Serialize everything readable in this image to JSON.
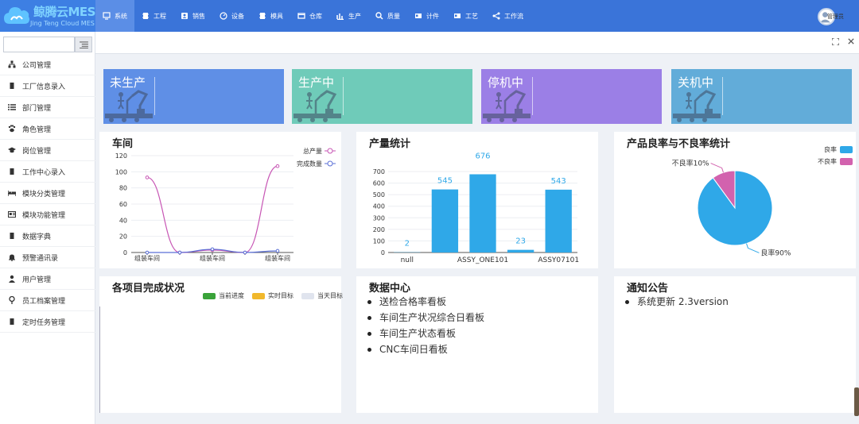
{
  "brand": {
    "title": "鲸腾云MES",
    "subtitle": "Jing Teng Cloud MES"
  },
  "nav": [
    {
      "label": "系统",
      "icon": "monitor-icon",
      "active": true
    },
    {
      "label": "工程",
      "icon": "chip-icon"
    },
    {
      "label": "销售",
      "icon": "user-badge-icon"
    },
    {
      "label": "设备",
      "icon": "gauge-icon"
    },
    {
      "label": "模具",
      "icon": "chip-icon"
    },
    {
      "label": "仓库",
      "icon": "window-icon"
    },
    {
      "label": "生产",
      "icon": "bar-chart-icon"
    },
    {
      "label": "质量",
      "icon": "search-icon"
    },
    {
      "label": "计件",
      "icon": "card-icon"
    },
    {
      "label": "工艺",
      "icon": "card-icon"
    },
    {
      "label": "工作流",
      "icon": "share-icon"
    }
  ],
  "user": {
    "name": "管理员"
  },
  "sidebar": {
    "search_placeholder": "",
    "items": [
      {
        "label": "公司管理",
        "icon": "sitemap-icon"
      },
      {
        "label": "工厂信息录入",
        "icon": "chip-icon"
      },
      {
        "label": "部门管理",
        "icon": "list-icon"
      },
      {
        "label": "角色管理",
        "icon": "paw-icon"
      },
      {
        "label": "岗位管理",
        "icon": "graduation-cap-icon"
      },
      {
        "label": "工作中心录入",
        "icon": "chip-icon"
      },
      {
        "label": "模块分类管理",
        "icon": "bed-icon"
      },
      {
        "label": "模块功能管理",
        "icon": "id-card-icon"
      },
      {
        "label": "数据字典",
        "icon": "chip-icon"
      },
      {
        "label": "预警通讯录",
        "icon": "bell-icon"
      },
      {
        "label": "用户管理",
        "icon": "user-icon"
      },
      {
        "label": "员工档案管理",
        "icon": "map-pin-icon"
      },
      {
        "label": "定时任务管理",
        "icon": "chip-icon"
      }
    ]
  },
  "status_cards": [
    {
      "label": "未生产",
      "color": "#5f8fe6"
    },
    {
      "label": "生产中",
      "color": "#6fcbb9"
    },
    {
      "label": "停机中",
      "color": "#9b7fe6"
    },
    {
      "label": "关机中",
      "color": "#62acd9"
    }
  ],
  "panels": {
    "workshop": {
      "title": "车间"
    },
    "output": {
      "title": "产量统计"
    },
    "yield": {
      "title": "产品良率与不良率统计"
    },
    "project": {
      "title": "各项目完成状况",
      "legend": [
        "当前进度",
        "实时目标",
        "当天目标"
      ],
      "legend_colors": [
        "#3aa33a",
        "#f1b82c",
        "#e0e4ee"
      ]
    },
    "datacenter": {
      "title": "数据中心",
      "items": [
        "送检合格率看板",
        "车间生产状况综合日看板",
        "车间生产状态看板",
        "CNC车间日看板"
      ]
    },
    "notice": {
      "title": "通知公告",
      "items": [
        "系统更新 2.3version"
      ]
    }
  },
  "chart_data": [
    {
      "type": "line",
      "title": "车间",
      "categories": [
        "组装车间",
        "",
        "组装车间",
        "",
        "组装车间"
      ],
      "series": [
        {
          "name": "总产量",
          "values": [
            93,
            0,
            3,
            0,
            107
          ],
          "color": "#c755b4"
        },
        {
          "name": "完成数量",
          "values": [
            0,
            0,
            4,
            0,
            2
          ],
          "color": "#5a6fd6"
        }
      ],
      "ylim": [
        0,
        120
      ],
      "yticks": [
        0,
        20,
        40,
        60,
        80,
        100,
        120
      ],
      "legend": "top-right"
    },
    {
      "type": "bar",
      "title": "产量统计",
      "categories": [
        "null",
        "",
        "ASSY_ONE101",
        "",
        "ASSY07101"
      ],
      "values": [
        2,
        545,
        676,
        23,
        543
      ],
      "ylim": [
        0,
        700
      ],
      "yticks": [
        0,
        100,
        200,
        300,
        400,
        500,
        600,
        700
      ],
      "color": "#2fa8e8"
    },
    {
      "type": "pie",
      "title": "产品良率与不良率统计",
      "slices": [
        {
          "name": "良率",
          "value": 90,
          "label": "良率90%",
          "color": "#2fa8e8"
        },
        {
          "name": "不良率",
          "value": 10,
          "label": "不良率10%",
          "color": "#d262ae"
        }
      ],
      "legend": "top-right"
    }
  ]
}
